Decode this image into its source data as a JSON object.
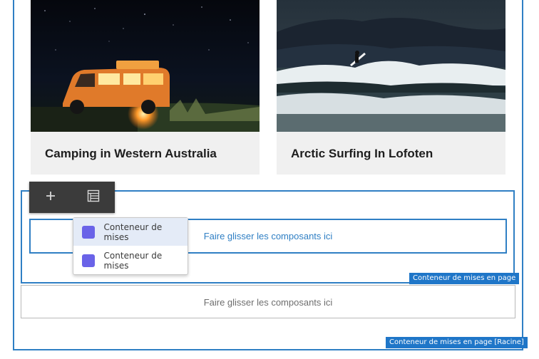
{
  "cards": [
    {
      "title": "Camping in Western Australia"
    },
    {
      "title": "Arctic Surfing In Lofoten"
    }
  ],
  "dropzones": {
    "inner_text": "Faire glisser les composants ici",
    "outer_text": "Faire glisser les composants ici"
  },
  "tags": {
    "layout_container": "Conteneur de mises en page",
    "root_container": "Conteneur de mises en page [Racine]"
  },
  "toolbar": {
    "add_icon": "plus-icon",
    "list_icon": "component-list-icon",
    "add_glyph": "+"
  },
  "popover": {
    "items": [
      {
        "label": "Conteneur de mises",
        "color": "#6a63e8"
      },
      {
        "label": "Conteneur de mises",
        "color": "#6a63e8"
      }
    ]
  },
  "colors": {
    "accent_blue": "#2f7fc4",
    "tag_bg": "#1f76c8",
    "toolbar_bg": "#3b3b3b",
    "card_bg": "#f0f0f0",
    "item_swatch": "#6a63e8"
  }
}
